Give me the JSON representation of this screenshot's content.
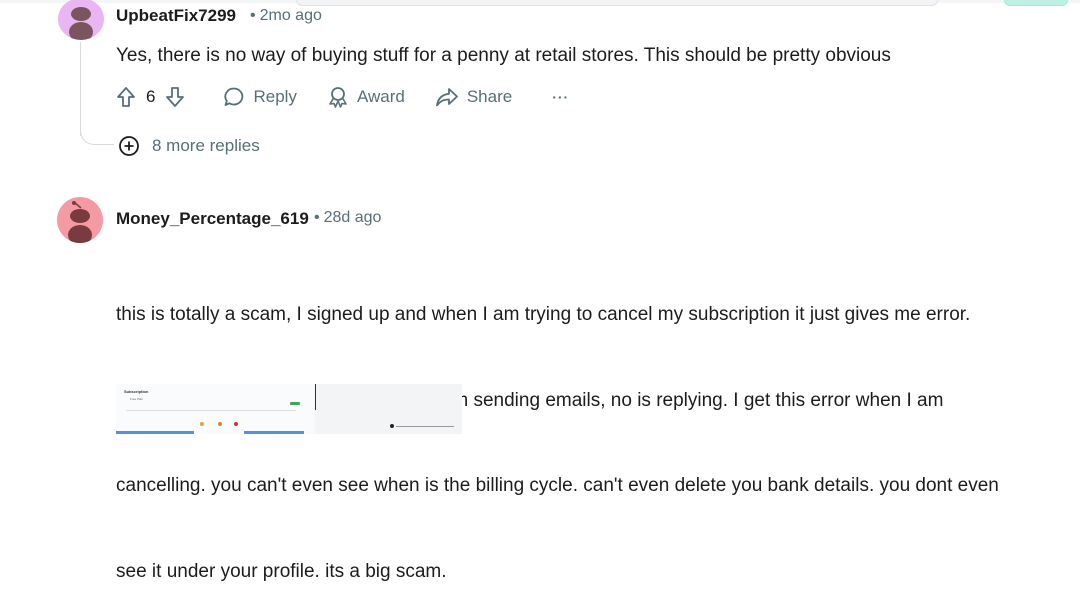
{
  "comments": [
    {
      "username": "UpbeatFix7299",
      "age": "2mo ago",
      "body": "Yes, there is no way of buying stuff for a penny at retail stores. This should be pretty obvious",
      "votes": "6",
      "avatar_color": "#e9b5f2"
    },
    {
      "username": "Money_Percentage_619",
      "age": "28d ago",
      "body_lines": [
        "this is totally a scam, I signed up and when I am trying to cancel my subscription it just gives me error.",
        "there support page doesn't get open. I am sending emails, no is replying. I get this error when I am",
        "cancelling. you can't even see when is the billing cycle. can't even delete you bank details. you dont even",
        "see it under your profile. its a big scam."
      ],
      "avatar_color": "#f49aa2"
    }
  ],
  "actions": {
    "reply_label": "Reply",
    "award_label": "Award",
    "share_label": "Share",
    "more_label": "···"
  },
  "more_replies_label": "8 more replies",
  "separator": "•",
  "thumbnail": {
    "heading": "Subscription",
    "plan_label": "Free Plan"
  },
  "colors": {
    "meta_gray": "#576f76",
    "text": "#1c1c1c",
    "thread_line": "#d6dadd"
  }
}
